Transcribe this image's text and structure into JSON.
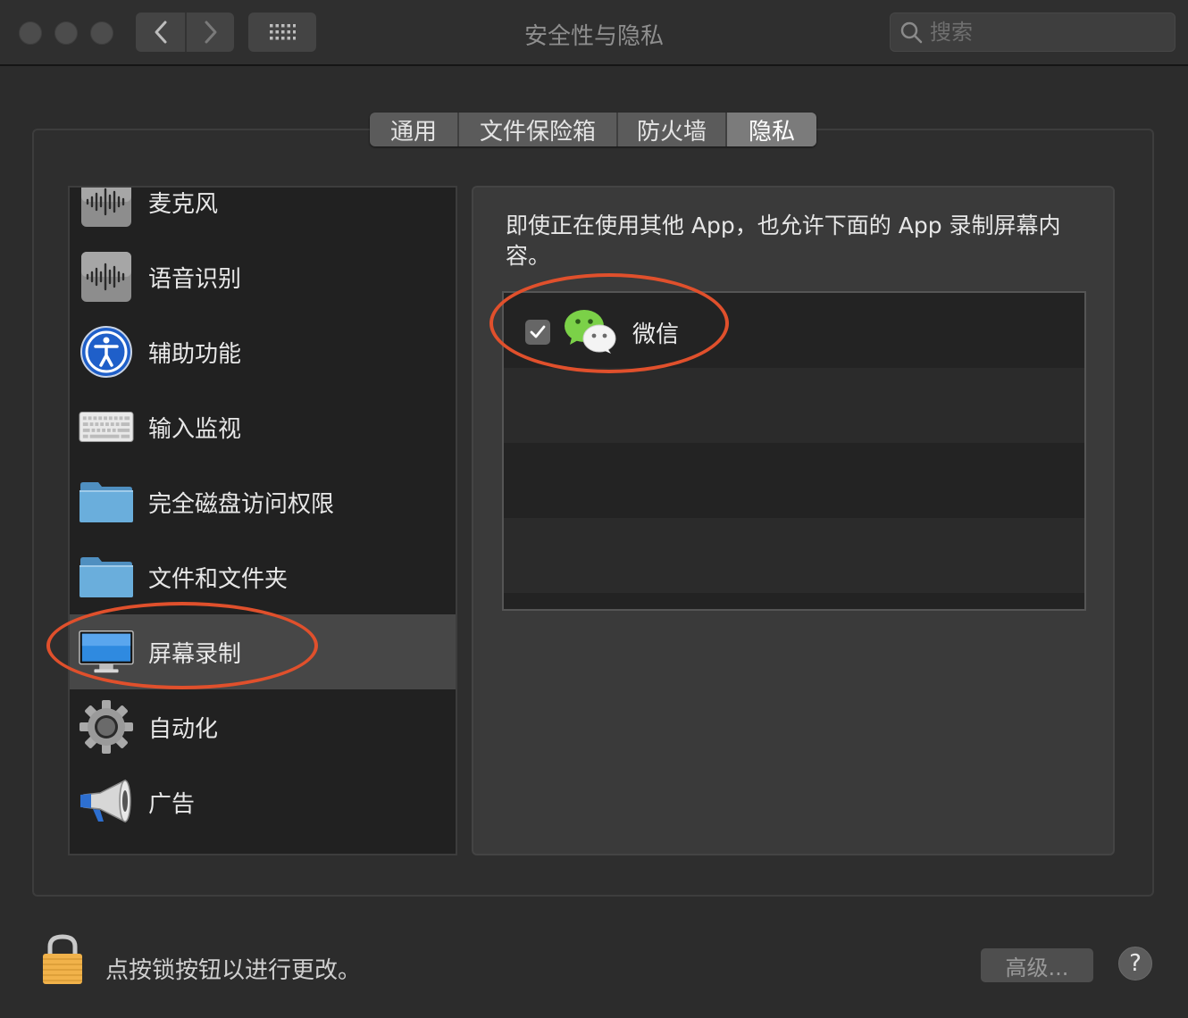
{
  "window": {
    "title": "安全性与隐私",
    "search_placeholder": "搜索"
  },
  "tabs": [
    {
      "label": "通用",
      "active": false
    },
    {
      "label": "文件保险箱",
      "active": false
    },
    {
      "label": "防火墙",
      "active": false
    },
    {
      "label": "隐私",
      "active": true
    }
  ],
  "sidebar": {
    "items": [
      {
        "label": "麦克风",
        "icon": "microphone-waveform-icon"
      },
      {
        "label": "语音识别",
        "icon": "speech-waveform-icon"
      },
      {
        "label": "辅助功能",
        "icon": "accessibility-icon"
      },
      {
        "label": "输入监视",
        "icon": "keyboard-icon"
      },
      {
        "label": "完全磁盘访问权限",
        "icon": "folder-icon"
      },
      {
        "label": "文件和文件夹",
        "icon": "folder-icon"
      },
      {
        "label": "屏幕录制",
        "icon": "display-icon",
        "selected": true
      },
      {
        "label": "自动化",
        "icon": "gear-icon"
      },
      {
        "label": "广告",
        "icon": "megaphone-icon"
      }
    ]
  },
  "right": {
    "description": "即使正在使用其他 App，也允许下面的 App 录制屏幕内容。",
    "apps": [
      {
        "name": "微信",
        "checked": true,
        "icon": "wechat-icon"
      }
    ]
  },
  "bottom": {
    "lock_text": "点按锁按钮以进行更改。",
    "advanced_label": "高级...",
    "help_label": "?"
  },
  "colors": {
    "annotation": "#e0502c",
    "selected_row": "#474747",
    "wechat_green": "#7bd148"
  }
}
